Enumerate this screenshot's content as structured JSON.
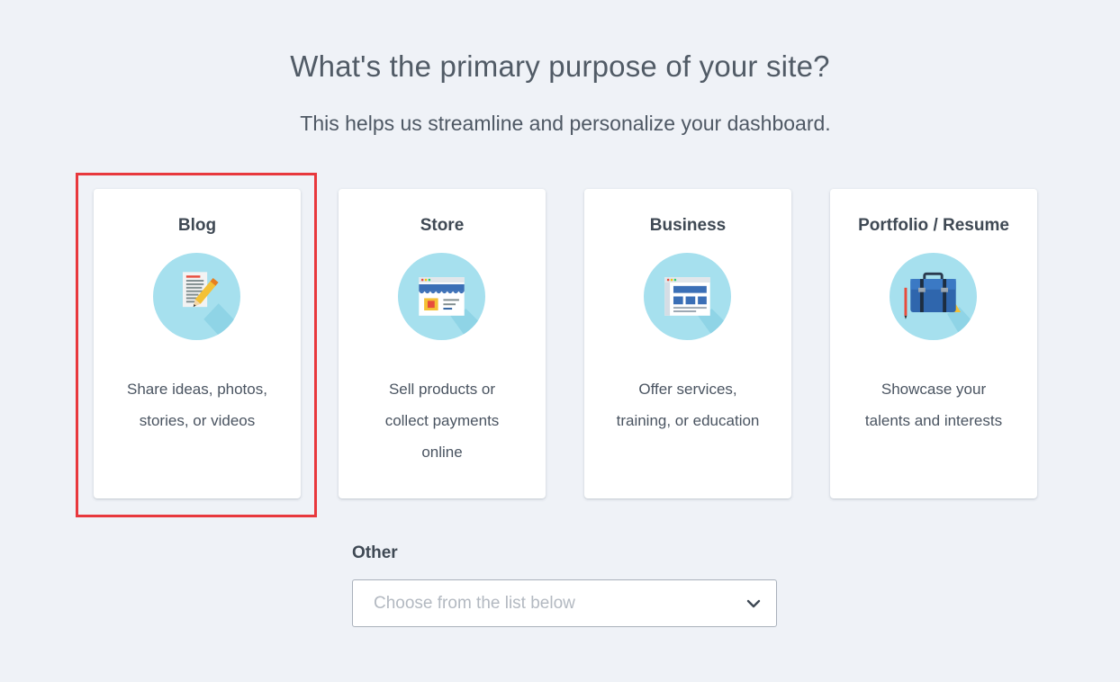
{
  "header": {
    "title": "What's the primary purpose of your site?",
    "subtitle": "This helps us streamline and personalize your dashboard."
  },
  "cards": [
    {
      "title": "Blog",
      "desc_lines": [
        "Share ideas, photos,",
        "stories, or videos"
      ],
      "icon": "blog-document-pencil-icon",
      "selected": true
    },
    {
      "title": "Store",
      "desc_lines": [
        "Sell products or",
        "collect payments",
        "online"
      ],
      "icon": "store-storefront-icon"
    },
    {
      "title": "Business",
      "desc_lines": [
        "Offer services,",
        "training, or education"
      ],
      "icon": "business-browser-window-icon"
    },
    {
      "title": "Portfolio / Resume",
      "desc_lines": [
        "Showcase your",
        "talents and interests"
      ],
      "icon": "portfolio-briefcase-icon"
    }
  ],
  "other": {
    "label": "Other",
    "placeholder": "Choose from the list below",
    "chevron_icon": "chevron-down-icon"
  },
  "colors": {
    "background": "#eff2f7",
    "icon_circle": "#a6e0ee",
    "highlight_border": "#e8383d"
  }
}
